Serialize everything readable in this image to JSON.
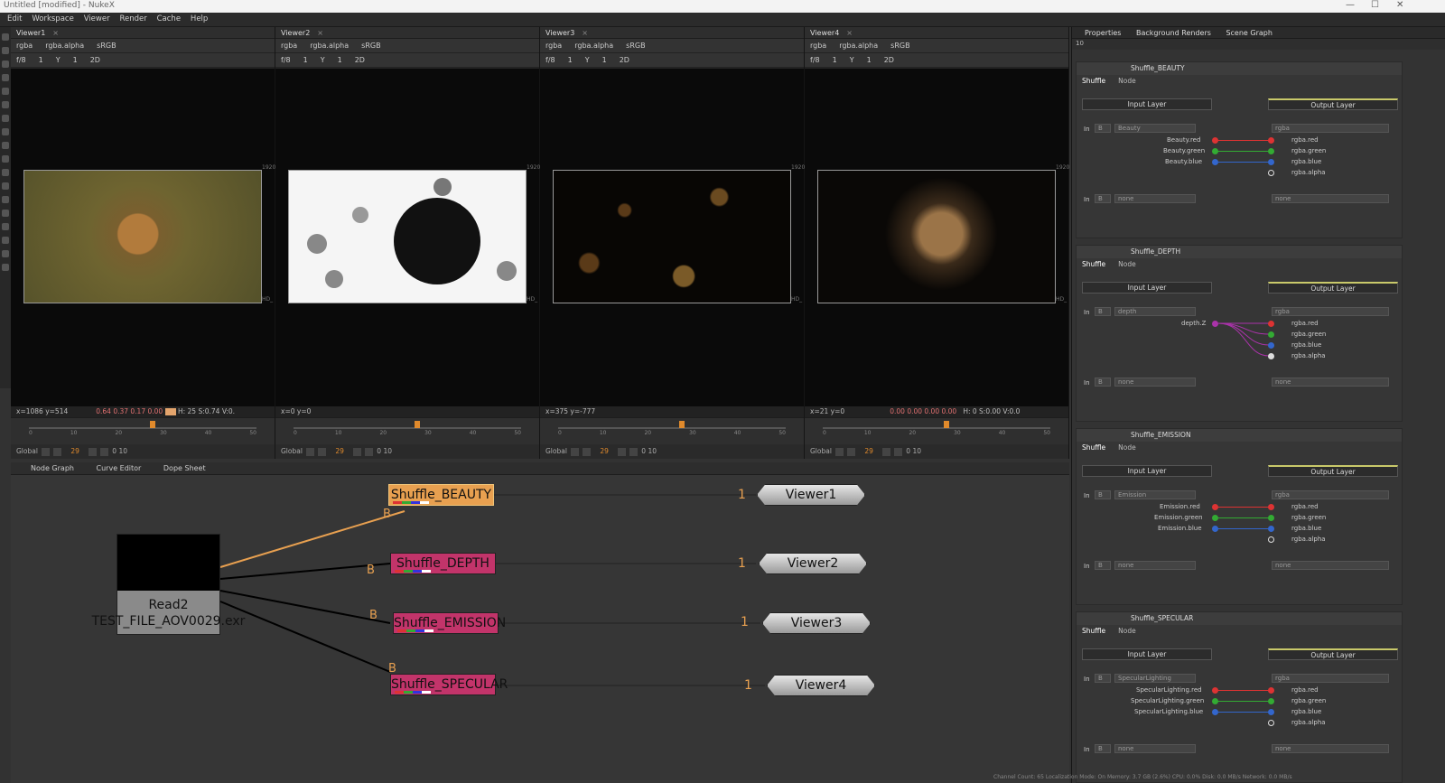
{
  "window": {
    "title": "Untitled [modified] - NukeX"
  },
  "menu": [
    "Edit",
    "Workspace",
    "Viewer",
    "Render",
    "Cache",
    "Help"
  ],
  "viewers": [
    {
      "tab": "Viewer1",
      "channels": "rgba",
      "alpha": "rgba.alpha",
      "colorspace": "sRGB",
      "fstop": "f/8",
      "frame_a": "1",
      "y": "Y",
      "y_val": "1",
      "view": "2D",
      "info": "x=1086 y=514",
      "rgb": "0.64 0.37 0.17 0.00",
      "hsv": "H: 25 S:0.74 V:0.",
      "format": "1920",
      "hd": "HD_",
      "timeline_frame": "29",
      "ticks": [
        "0",
        "10",
        "20",
        "30",
        "40",
        "50"
      ],
      "global": "Global",
      "step": "10",
      "end": "0"
    },
    {
      "tab": "Viewer2",
      "channels": "rgba",
      "alpha": "rgba.alpha",
      "colorspace": "sRGB",
      "fstop": "f/8",
      "frame_a": "1",
      "y": "Y",
      "y_val": "1",
      "view": "2D",
      "info": "x=0 y=0",
      "rgb": "",
      "hsv": "",
      "format": "1920",
      "hd": "HD_",
      "timeline_frame": "29",
      "ticks": [
        "0",
        "10",
        "20",
        "30",
        "40",
        "50"
      ],
      "global": "Global",
      "step": "10",
      "end": "0"
    },
    {
      "tab": "Viewer3",
      "channels": "rgba",
      "alpha": "rgba.alpha",
      "colorspace": "sRGB",
      "fstop": "f/8",
      "frame_a": "1",
      "y": "Y",
      "y_val": "1",
      "view": "2D",
      "info": "x=375 y=-777",
      "rgb": "",
      "hsv": "",
      "format": "1920",
      "hd": "HD_",
      "timeline_frame": "29",
      "ticks": [
        "0",
        "10",
        "20",
        "30",
        "40",
        "50"
      ],
      "global": "Global",
      "step": "10",
      "end": "0"
    },
    {
      "tab": "Viewer4",
      "channels": "rgba",
      "alpha": "rgba.alpha",
      "colorspace": "sRGB",
      "fstop": "f/8",
      "frame_a": "1",
      "y": "Y",
      "y_val": "1",
      "view": "2D",
      "info": "x=21 y=0",
      "rgb": "0.00 0.00 0.00 0.00",
      "hsv": "H: 0 S:0.00 V:0.0",
      "format": "1920",
      "hd": "HD_",
      "timeline_frame": "29",
      "ticks": [
        "0",
        "10",
        "20",
        "30",
        "40",
        "50"
      ],
      "global": "Global",
      "step": "10",
      "end": "0"
    }
  ],
  "nodegraph": {
    "tabs": [
      "Node Graph",
      "Curve Editor",
      "Dope Sheet"
    ],
    "read": {
      "name": "Read2",
      "file": "TEST_FILE_AOV0029.exr"
    },
    "shuffles": [
      "Shuffle_BEAUTY",
      "Shuffle_DEPTH",
      "Shuffle_EMISSION",
      "Shuffle_SPECULAR"
    ],
    "viewers": [
      "Viewer1",
      "Viewer2",
      "Viewer3",
      "Viewer4"
    ],
    "input_one": "1",
    "input_b": "B"
  },
  "properties": {
    "tabs": [
      "Properties",
      "Background Renders",
      "Scene Graph"
    ],
    "count": "10",
    "panels": [
      {
        "name": "Shuffle_BEAUTY",
        "tab1": "Shuffle",
        "tab2": "Node",
        "in_label": "Input Layer",
        "out_label": "Output Layer",
        "in": "In",
        "b": "B",
        "layer": "Beauty",
        "out_layer": "rgba",
        "channels": [
          "Beauty.red",
          "Beauty.green",
          "Beauty.blue"
        ],
        "outs": [
          "rgba.red",
          "rgba.green",
          "rgba.blue",
          "rgba.alpha"
        ],
        "none": "none"
      },
      {
        "name": "Shuffle_DEPTH",
        "tab1": "Shuffle",
        "tab2": "Node",
        "in_label": "Input Layer",
        "out_label": "Output Layer",
        "in": "In",
        "b": "B",
        "layer": "depth",
        "out_layer": "rgba",
        "channels": [
          "depth.Z"
        ],
        "outs": [
          "rgba.red",
          "rgba.green",
          "rgba.blue",
          "rgba.alpha"
        ],
        "none": "none"
      },
      {
        "name": "Shuffle_EMISSION",
        "tab1": "Shuffle",
        "tab2": "Node",
        "in_label": "Input Layer",
        "out_label": "Output Layer",
        "in": "In",
        "b": "B",
        "layer": "Emission",
        "out_layer": "rgba",
        "channels": [
          "Emission.red",
          "Emission.green",
          "Emission.blue"
        ],
        "outs": [
          "rgba.red",
          "rgba.green",
          "rgba.blue",
          "rgba.alpha"
        ],
        "none": "none"
      },
      {
        "name": "Shuffle_SPECULAR",
        "tab1": "Shuffle",
        "tab2": "Node",
        "in_label": "Input Layer",
        "out_label": "Output Layer",
        "in": "In",
        "b": "B",
        "layer": "SpecularLighting",
        "out_layer": "rgba",
        "channels": [
          "SpecularLighting.red",
          "SpecularLighting.green",
          "SpecularLighting.blue"
        ],
        "outs": [
          "rgba.red",
          "rgba.green",
          "rgba.blue",
          "rgba.alpha"
        ],
        "none": "none"
      }
    ]
  },
  "status": "Channel Count: 65  Localization Mode: On  Memory: 3.7 GB (2.6%)  CPU: 0.0%  Disk: 0.0 MB/s  Network: 0.0 MB/s",
  "colors": {
    "accent": "#e8a050",
    "shuffle": "#c2346a",
    "red": "#d33",
    "green": "#3a3",
    "blue": "#36c"
  }
}
